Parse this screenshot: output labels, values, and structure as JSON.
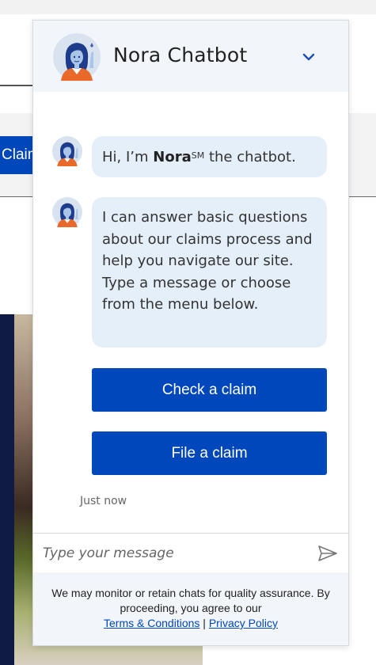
{
  "background": {
    "claim_button_label": "Claim"
  },
  "chat": {
    "title": "Nora Chatbot",
    "collapse_icon": "chevron-down-icon",
    "messages": [
      {
        "prefix": "Hi, I’m ",
        "name": "Nora",
        "mark": "SM",
        "suffix": " the chatbot."
      },
      {
        "text": "I can answer basic questions about our claims process and help you navigate our site. Type a message or choose from the menu below."
      }
    ],
    "actions": [
      {
        "label": "Check a claim"
      },
      {
        "label": "File a claim"
      }
    ],
    "timestamp": "Just now",
    "input": {
      "placeholder": "Type your message",
      "value": ""
    },
    "send_icon": "send-icon",
    "footer": {
      "text": "We may monitor or retain chats for quality assurance. By proceeding, you agree to our",
      "terms_link": "Terms & Conditions",
      "separator": "|",
      "privacy_link": "Privacy Policy"
    },
    "colors": {
      "accent": "#0047bb",
      "bubble": "#e4effa",
      "header": "#f2f5f9"
    }
  }
}
